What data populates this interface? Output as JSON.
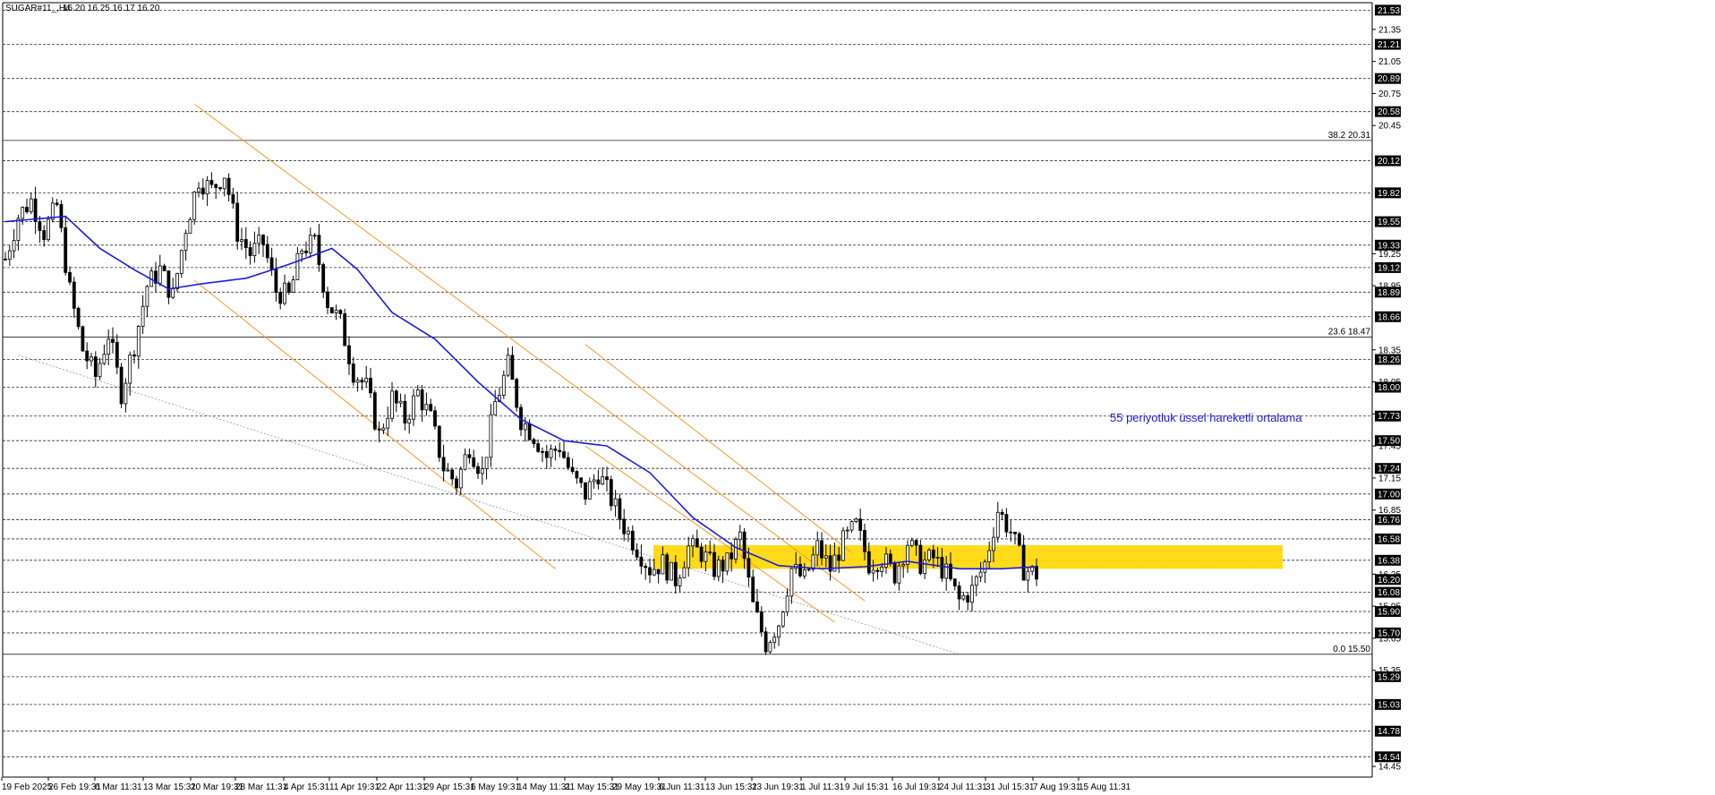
{
  "header": {
    "symbol": "SUGAR#11_,H4",
    "ohlc": "16.20 16.25 16.17 16.20"
  },
  "chart_data": {
    "type": "candlestick",
    "title": "",
    "ylim": [
      14.35,
      21.6
    ],
    "grid": true,
    "price_levels": [
      {
        "value": 21.53,
        "label": "21.53",
        "style": "dashed",
        "badge": true
      },
      {
        "value": 21.21,
        "label": "21.21",
        "style": "dashed",
        "badge": true
      },
      {
        "value": 20.89,
        "label": "20.89",
        "style": "dashed",
        "badge": true
      },
      {
        "value": 20.58,
        "label": "20.58",
        "style": "dashed",
        "badge": true
      },
      {
        "value": 20.12,
        "label": "20.12",
        "style": "dashed",
        "badge": true
      },
      {
        "value": 19.82,
        "label": "19.82",
        "style": "dashed",
        "badge": true
      },
      {
        "value": 19.55,
        "label": "19.55",
        "style": "dashed",
        "badge": true
      },
      {
        "value": 19.33,
        "label": "19.33",
        "style": "dashed",
        "badge": true
      },
      {
        "value": 19.12,
        "label": "19.12",
        "style": "dashed",
        "badge": true
      },
      {
        "value": 18.89,
        "label": "18.89",
        "style": "dashed",
        "badge": true
      },
      {
        "value": 18.66,
        "label": "18.66",
        "style": "dashed",
        "badge": true
      },
      {
        "value": 18.26,
        "label": "18.26",
        "style": "dashed",
        "badge": true
      },
      {
        "value": 18.0,
        "label": "18.00",
        "style": "dashed",
        "badge": true
      },
      {
        "value": 17.73,
        "label": "17.73",
        "style": "dashed",
        "badge": true
      },
      {
        "value": 17.5,
        "label": "17.50",
        "style": "dashed",
        "badge": true
      },
      {
        "value": 17.24,
        "label": "17.24",
        "style": "dashed",
        "badge": true
      },
      {
        "value": 17.0,
        "label": "17.00",
        "style": "dashed",
        "badge": true
      },
      {
        "value": 16.76,
        "label": "16.76",
        "style": "dashed",
        "badge": true
      },
      {
        "value": 16.58,
        "label": "16.58",
        "style": "dashed",
        "badge": true
      },
      {
        "value": 16.38,
        "label": "16.38",
        "style": "dashed",
        "badge": true
      },
      {
        "value": 16.2,
        "label": "16.20",
        "style": "none",
        "badge": true
      },
      {
        "value": 16.08,
        "label": "16.08",
        "style": "dashed",
        "badge": true
      },
      {
        "value": 15.9,
        "label": "15.90",
        "style": "dashed",
        "badge": true
      },
      {
        "value": 15.7,
        "label": "15.70",
        "style": "dashed",
        "badge": true
      },
      {
        "value": 15.29,
        "label": "15.29",
        "style": "dashed",
        "badge": true
      },
      {
        "value": 15.03,
        "label": "15.03",
        "style": "dashed",
        "badge": true
      },
      {
        "value": 14.78,
        "label": "14.78",
        "style": "dashed",
        "badge": true
      },
      {
        "value": 14.54,
        "label": "14.54",
        "style": "dashed",
        "badge": true
      }
    ],
    "y_ticks": [
      "21.35",
      "21.05",
      "20.75",
      "20.45",
      "19.25",
      "18.95",
      "18.35",
      "18.05",
      "17.75",
      "17.45",
      "17.15",
      "16.85",
      "16.25",
      "15.95",
      "15.65",
      "15.35",
      "14.45"
    ],
    "fib_levels": [
      {
        "value": 20.31,
        "label": "38.2 20.31"
      },
      {
        "value": 18.47,
        "label": "23.6 18.47"
      },
      {
        "value": 15.5,
        "label": "0.0 15.50"
      }
    ],
    "x_labels": [
      "19 Feb 2025",
      "26 Feb 19:31",
      "6 Mar 11:31",
      "13 Mar 15:31",
      "20 Mar 19:31",
      "28 Mar 11:31",
      "4 Apr 15:31",
      "11 Apr 19:31",
      "22 Apr 11:31",
      "29 Apr 15:31",
      "6 May 19:31",
      "14 May 11:31",
      "21 May 15:31",
      "29 May 19:31",
      "6 Jun 11:31",
      "13 Jun 15:31",
      "23 Jun 19:31",
      "1 Jul 11:31",
      "9 Jul 15:31",
      "16 Jul 19:31",
      "24 Jul 11:31",
      "31 Jul 15:31",
      "7 Aug 19:31",
      "15 Aug 11:31"
    ],
    "price_path": [
      [
        0,
        19.2
      ],
      [
        3,
        19.6
      ],
      [
        6,
        19.75
      ],
      [
        9,
        19.45
      ],
      [
        12,
        19.7
      ],
      [
        15,
        18.9
      ],
      [
        18,
        18.35
      ],
      [
        21,
        18.1
      ],
      [
        24,
        18.5
      ],
      [
        27,
        17.95
      ],
      [
        30,
        18.4
      ],
      [
        33,
        18.95
      ],
      [
        36,
        19.1
      ],
      [
        39,
        18.85
      ],
      [
        42,
        19.5
      ],
      [
        45,
        19.95
      ],
      [
        48,
        19.85
      ],
      [
        51,
        20.0
      ],
      [
        54,
        19.45
      ],
      [
        57,
        19.25
      ],
      [
        60,
        19.35
      ],
      [
        63,
        18.9
      ],
      [
        66,
        18.85
      ],
      [
        69,
        19.3
      ],
      [
        72,
        19.35
      ],
      [
        75,
        18.8
      ],
      [
        78,
        18.6
      ],
      [
        81,
        18.15
      ],
      [
        84,
        18.0
      ],
      [
        87,
        17.55
      ],
      [
        90,
        17.9
      ],
      [
        93,
        17.7
      ],
      [
        96,
        17.95
      ],
      [
        99,
        17.7
      ],
      [
        102,
        17.25
      ],
      [
        105,
        17.1
      ],
      [
        108,
        17.45
      ],
      [
        111,
        17.2
      ],
      [
        114,
        17.85
      ],
      [
        117,
        18.2
      ],
      [
        120,
        17.7
      ],
      [
        123,
        17.55
      ],
      [
        126,
        17.35
      ],
      [
        129,
        17.45
      ],
      [
        132,
        17.15
      ],
      [
        135,
        17.0
      ],
      [
        138,
        17.2
      ],
      [
        141,
        16.95
      ],
      [
        144,
        16.7
      ],
      [
        147,
        16.5
      ],
      [
        150,
        16.3
      ],
      [
        153,
        16.35
      ],
      [
        156,
        16.2
      ],
      [
        159,
        16.5
      ],
      [
        162,
        16.45
      ],
      [
        165,
        16.3
      ],
      [
        168,
        16.35
      ],
      [
        171,
        16.6
      ],
      [
        174,
        15.95
      ],
      [
        177,
        15.6
      ],
      [
        180,
        15.8
      ],
      [
        183,
        16.3
      ],
      [
        186,
        16.2
      ],
      [
        189,
        16.5
      ],
      [
        192,
        16.3
      ],
      [
        195,
        16.55
      ],
      [
        198,
        16.7
      ],
      [
        201,
        16.35
      ],
      [
        204,
        16.4
      ],
      [
        207,
        16.25
      ],
      [
        210,
        16.55
      ],
      [
        213,
        16.35
      ],
      [
        216,
        16.4
      ],
      [
        219,
        16.25
      ],
      [
        222,
        16.0
      ],
      [
        225,
        16.1
      ],
      [
        228,
        16.35
      ],
      [
        231,
        16.85
      ],
      [
        234,
        16.65
      ],
      [
        237,
        16.3
      ],
      [
        240,
        16.25
      ]
    ],
    "series": [
      {
        "name": "55 periyotluk üssel hareketli ortalama",
        "type": "ema",
        "color": "#1c1ce0",
        "points": [
          [
            0,
            19.55
          ],
          [
            14,
            19.6
          ],
          [
            22,
            19.3
          ],
          [
            30,
            19.1
          ],
          [
            38,
            18.92
          ],
          [
            46,
            18.97
          ],
          [
            56,
            19.02
          ],
          [
            66,
            19.15
          ],
          [
            76,
            19.3
          ],
          [
            82,
            19.1
          ],
          [
            90,
            18.7
          ],
          [
            100,
            18.45
          ],
          [
            110,
            18.05
          ],
          [
            120,
            17.7
          ],
          [
            130,
            17.5
          ],
          [
            140,
            17.45
          ],
          [
            150,
            17.2
          ],
          [
            160,
            16.78
          ],
          [
            170,
            16.5
          ],
          [
            180,
            16.33
          ],
          [
            190,
            16.3
          ],
          [
            200,
            16.32
          ],
          [
            210,
            16.37
          ],
          [
            222,
            16.3
          ],
          [
            232,
            16.3
          ],
          [
            240,
            16.32
          ]
        ]
      }
    ],
    "trend_channels": [
      {
        "color": "#f39a2a",
        "lines": [
          [
            [
              44,
              20.65
            ],
            [
              200,
              16.0
            ]
          ],
          [
            [
              44,
              19.0
            ],
            [
              128,
              16.3
            ]
          ]
        ]
      },
      {
        "color": "#f39a2a",
        "lines": [
          [
            [
              135,
              18.4
            ],
            [
              197,
              16.45
            ]
          ],
          [
            [
              135,
              17.45
            ],
            [
              193,
              15.8
            ]
          ]
        ]
      }
    ],
    "support_line": {
      "from": [
        3,
        18.3
      ],
      "to": [
        222,
        15.5
      ]
    },
    "zone": {
      "from_x": 180,
      "to_x": 357,
      "low": 16.3,
      "high": 16.52,
      "color": "#ffd700"
    },
    "annotations": [
      {
        "text": "55 periyotluk üssel hareketli ortalama",
        "color": "#1c1ce0"
      }
    ],
    "current_price": 16.2
  }
}
